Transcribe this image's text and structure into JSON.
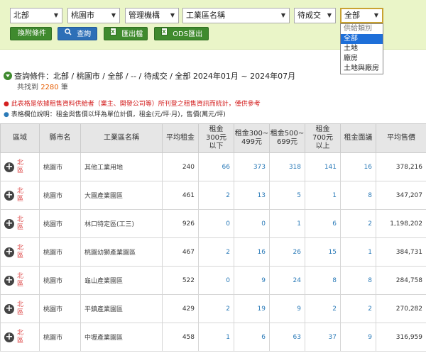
{
  "filters": {
    "region": "北部",
    "city": "桃園市",
    "agency": "管理機構",
    "park": "工業區名稱",
    "status": "待成交",
    "category": "全部"
  },
  "dropdown": {
    "options": [
      "供給類別",
      "全部",
      "土地",
      "廠房",
      "土地與廠房"
    ]
  },
  "buttons": {
    "attachment": "換附條件",
    "search": "查詢",
    "export_excel": "匯出檔",
    "export_ods": "ODS匯出"
  },
  "query": {
    "label": "查詢條件：北部 / 桃園市 / 全部 / -- / 待成交 / 全部 2024年01月 ~ 2024年07月",
    "found_prefix": "共找到",
    "count": "2280",
    "found_suffix": "筆"
  },
  "notes": {
    "note1": "此表格是依據租售資料供給者（業主、開發公司等）所刊登之租售資訊而統計，僅供參考",
    "note2": "表格欄位說明：租金與售價以坪為單位計價，租金(元/坪·月)，售價(萬元/坪)"
  },
  "table": {
    "headers": [
      "區域",
      "縣市名",
      "工業區名稱",
      "平均租金",
      "租金\n300元\n以下",
      "租金300~\n499元",
      "租金500~\n699元",
      "租金\n700元\n以上",
      "租金面議",
      "平均售價"
    ],
    "rows": [
      {
        "region": "北區",
        "city": "桃園市",
        "park": "其他工業用地",
        "avg_rent": "240",
        "r1": "66",
        "r2": "373",
        "r3": "318",
        "r4": "141",
        "neg": "16",
        "avg_price": "378,216"
      },
      {
        "region": "北區",
        "city": "桃園市",
        "park": "大園產業園區",
        "avg_rent": "461",
        "r1": "2",
        "r2": "13",
        "r3": "5",
        "r4": "1",
        "neg": "8",
        "avg_price": "347,207"
      },
      {
        "region": "北區",
        "city": "桃園市",
        "park": "林口特定區(工三)",
        "avg_rent": "926",
        "r1": "0",
        "r2": "0",
        "r3": "1",
        "r4": "6",
        "neg": "2",
        "avg_price": "1,198,202"
      },
      {
        "region": "北區",
        "city": "桃園市",
        "park": "桃園幼獅產業園區",
        "avg_rent": "467",
        "r1": "2",
        "r2": "16",
        "r3": "26",
        "r4": "15",
        "neg": "1",
        "avg_price": "384,731"
      },
      {
        "region": "北區",
        "city": "桃園市",
        "park": "龜山產業園區",
        "avg_rent": "522",
        "r1": "0",
        "r2": "9",
        "r3": "24",
        "r4": "8",
        "neg": "8",
        "avg_price": "284,758"
      },
      {
        "region": "北區",
        "city": "桃園市",
        "park": "平鎮產業園區",
        "avg_rent": "429",
        "r1": "2",
        "r2": "19",
        "r3": "9",
        "r4": "2",
        "neg": "2",
        "avg_price": "270,282"
      },
      {
        "region": "北區",
        "city": "桃園市",
        "park": "中壢產業園區",
        "avg_rent": "458",
        "r1": "1",
        "r2": "6",
        "r3": "63",
        "r4": "37",
        "neg": "9",
        "avg_price": "316,959"
      }
    ]
  }
}
